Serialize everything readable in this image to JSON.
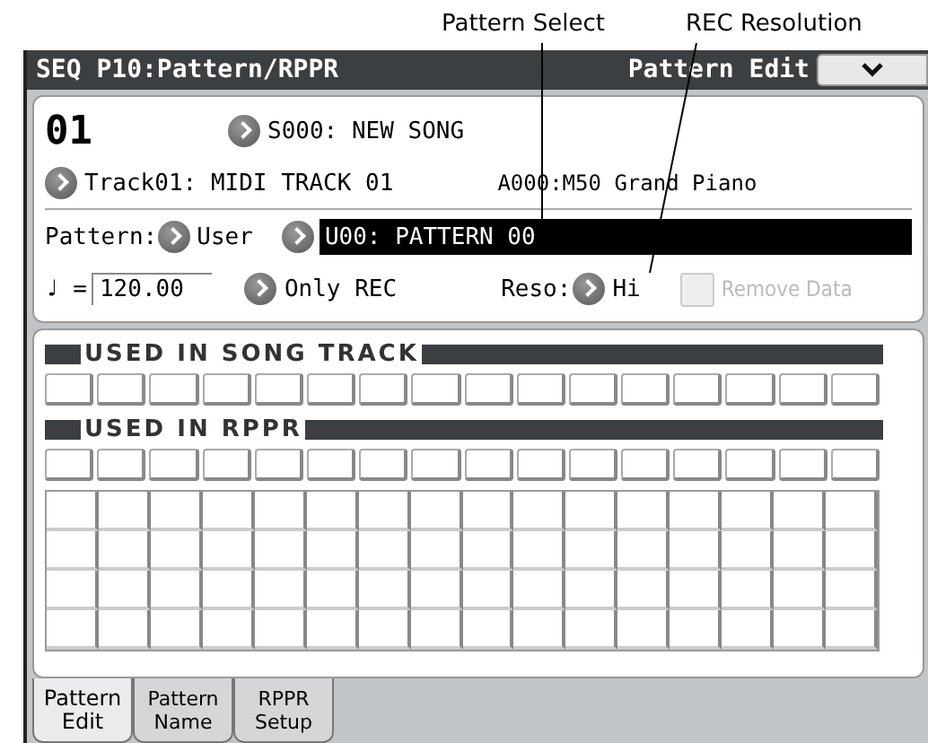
{
  "callouts": [
    {
      "label": "Pattern Select"
    },
    {
      "label": "REC Resolution"
    }
  ],
  "header": {
    "title": "SEQ P10:Pattern/RPPR",
    "mode": "Pattern Edit"
  },
  "song": {
    "number": "01",
    "name": "S000: NEW SONG"
  },
  "track": {
    "name": "Track01: MIDI TRACK 01",
    "program": "A000:M50 Grand Piano"
  },
  "pattern": {
    "label": "Pattern:",
    "bank": "User",
    "name": "U00: PATTERN 00"
  },
  "controls": {
    "tempo_symbol": "♩ =",
    "tempo": "120.00",
    "rec_mode": "Only REC",
    "reso_label": "Reso:",
    "reso": "Hi"
  },
  "remove_data": {
    "label": "Remove Data",
    "checked": false,
    "disabled": true
  },
  "sections": [
    {
      "title": "USED IN SONG TRACK",
      "kind": "row"
    },
    {
      "title": "USED IN RPPR",
      "kind": "grid"
    }
  ],
  "tabs": [
    {
      "label": [
        "Pattern",
        "Edit"
      ],
      "selected": true
    },
    {
      "label": [
        "Pattern",
        "Name"
      ],
      "selected": false
    },
    {
      "label": [
        "RPPR",
        "Setup"
      ],
      "selected": false
    }
  ]
}
